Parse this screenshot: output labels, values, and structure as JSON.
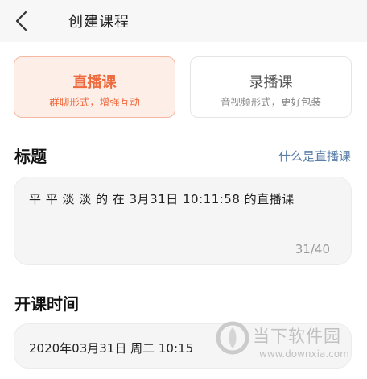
{
  "header": {
    "title": "创建课程"
  },
  "course_types": [
    {
      "name": "直播课",
      "desc": "群聊形式，增强互动",
      "selected": true
    },
    {
      "name": "录播课",
      "desc": "音视频形式，更好包装",
      "selected": false
    }
  ],
  "title_section": {
    "heading": "标题",
    "help_link": "什么是直播课",
    "value": "平 平 淡 淡 的 在 3月31日 10:11:58 的直播课",
    "counter": "31/40"
  },
  "time_section": {
    "heading": "开课时间",
    "value": "2020年03月31日 周二 10:15"
  },
  "watermark": {
    "name": "当下软件园",
    "url": "www.downxia.com"
  },
  "colors": {
    "accent": "#ee6a3c",
    "link": "#5a7fa8"
  }
}
